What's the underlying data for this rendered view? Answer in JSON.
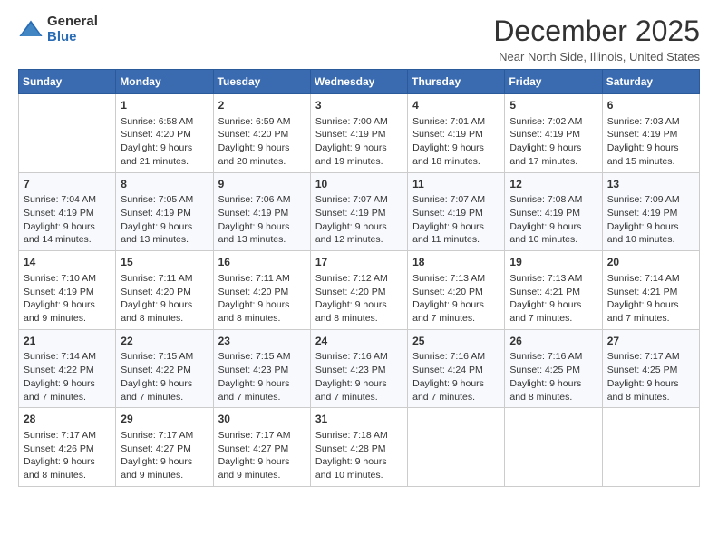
{
  "logo": {
    "general": "General",
    "blue": "Blue"
  },
  "header": {
    "month": "December 2025",
    "location": "Near North Side, Illinois, United States"
  },
  "days_of_week": [
    "Sunday",
    "Monday",
    "Tuesday",
    "Wednesday",
    "Thursday",
    "Friday",
    "Saturday"
  ],
  "weeks": [
    [
      {
        "day": "",
        "info": ""
      },
      {
        "day": "1",
        "info": "Sunrise: 6:58 AM\nSunset: 4:20 PM\nDaylight: 9 hours\nand 21 minutes."
      },
      {
        "day": "2",
        "info": "Sunrise: 6:59 AM\nSunset: 4:20 PM\nDaylight: 9 hours\nand 20 minutes."
      },
      {
        "day": "3",
        "info": "Sunrise: 7:00 AM\nSunset: 4:19 PM\nDaylight: 9 hours\nand 19 minutes."
      },
      {
        "day": "4",
        "info": "Sunrise: 7:01 AM\nSunset: 4:19 PM\nDaylight: 9 hours\nand 18 minutes."
      },
      {
        "day": "5",
        "info": "Sunrise: 7:02 AM\nSunset: 4:19 PM\nDaylight: 9 hours\nand 17 minutes."
      },
      {
        "day": "6",
        "info": "Sunrise: 7:03 AM\nSunset: 4:19 PM\nDaylight: 9 hours\nand 15 minutes."
      }
    ],
    [
      {
        "day": "7",
        "info": "Sunrise: 7:04 AM\nSunset: 4:19 PM\nDaylight: 9 hours\nand 14 minutes."
      },
      {
        "day": "8",
        "info": "Sunrise: 7:05 AM\nSunset: 4:19 PM\nDaylight: 9 hours\nand 13 minutes."
      },
      {
        "day": "9",
        "info": "Sunrise: 7:06 AM\nSunset: 4:19 PM\nDaylight: 9 hours\nand 13 minutes."
      },
      {
        "day": "10",
        "info": "Sunrise: 7:07 AM\nSunset: 4:19 PM\nDaylight: 9 hours\nand 12 minutes."
      },
      {
        "day": "11",
        "info": "Sunrise: 7:07 AM\nSunset: 4:19 PM\nDaylight: 9 hours\nand 11 minutes."
      },
      {
        "day": "12",
        "info": "Sunrise: 7:08 AM\nSunset: 4:19 PM\nDaylight: 9 hours\nand 10 minutes."
      },
      {
        "day": "13",
        "info": "Sunrise: 7:09 AM\nSunset: 4:19 PM\nDaylight: 9 hours\nand 10 minutes."
      }
    ],
    [
      {
        "day": "14",
        "info": "Sunrise: 7:10 AM\nSunset: 4:19 PM\nDaylight: 9 hours\nand 9 minutes."
      },
      {
        "day": "15",
        "info": "Sunrise: 7:11 AM\nSunset: 4:20 PM\nDaylight: 9 hours\nand 8 minutes."
      },
      {
        "day": "16",
        "info": "Sunrise: 7:11 AM\nSunset: 4:20 PM\nDaylight: 9 hours\nand 8 minutes."
      },
      {
        "day": "17",
        "info": "Sunrise: 7:12 AM\nSunset: 4:20 PM\nDaylight: 9 hours\nand 8 minutes."
      },
      {
        "day": "18",
        "info": "Sunrise: 7:13 AM\nSunset: 4:20 PM\nDaylight: 9 hours\nand 7 minutes."
      },
      {
        "day": "19",
        "info": "Sunrise: 7:13 AM\nSunset: 4:21 PM\nDaylight: 9 hours\nand 7 minutes."
      },
      {
        "day": "20",
        "info": "Sunrise: 7:14 AM\nSunset: 4:21 PM\nDaylight: 9 hours\nand 7 minutes."
      }
    ],
    [
      {
        "day": "21",
        "info": "Sunrise: 7:14 AM\nSunset: 4:22 PM\nDaylight: 9 hours\nand 7 minutes."
      },
      {
        "day": "22",
        "info": "Sunrise: 7:15 AM\nSunset: 4:22 PM\nDaylight: 9 hours\nand 7 minutes."
      },
      {
        "day": "23",
        "info": "Sunrise: 7:15 AM\nSunset: 4:23 PM\nDaylight: 9 hours\nand 7 minutes."
      },
      {
        "day": "24",
        "info": "Sunrise: 7:16 AM\nSunset: 4:23 PM\nDaylight: 9 hours\nand 7 minutes."
      },
      {
        "day": "25",
        "info": "Sunrise: 7:16 AM\nSunset: 4:24 PM\nDaylight: 9 hours\nand 7 minutes."
      },
      {
        "day": "26",
        "info": "Sunrise: 7:16 AM\nSunset: 4:25 PM\nDaylight: 9 hours\nand 8 minutes."
      },
      {
        "day": "27",
        "info": "Sunrise: 7:17 AM\nSunset: 4:25 PM\nDaylight: 9 hours\nand 8 minutes."
      }
    ],
    [
      {
        "day": "28",
        "info": "Sunrise: 7:17 AM\nSunset: 4:26 PM\nDaylight: 9 hours\nand 8 minutes."
      },
      {
        "day": "29",
        "info": "Sunrise: 7:17 AM\nSunset: 4:27 PM\nDaylight: 9 hours\nand 9 minutes."
      },
      {
        "day": "30",
        "info": "Sunrise: 7:17 AM\nSunset: 4:27 PM\nDaylight: 9 hours\nand 9 minutes."
      },
      {
        "day": "31",
        "info": "Sunrise: 7:18 AM\nSunset: 4:28 PM\nDaylight: 9 hours\nand 10 minutes."
      },
      {
        "day": "",
        "info": ""
      },
      {
        "day": "",
        "info": ""
      },
      {
        "day": "",
        "info": ""
      }
    ]
  ]
}
